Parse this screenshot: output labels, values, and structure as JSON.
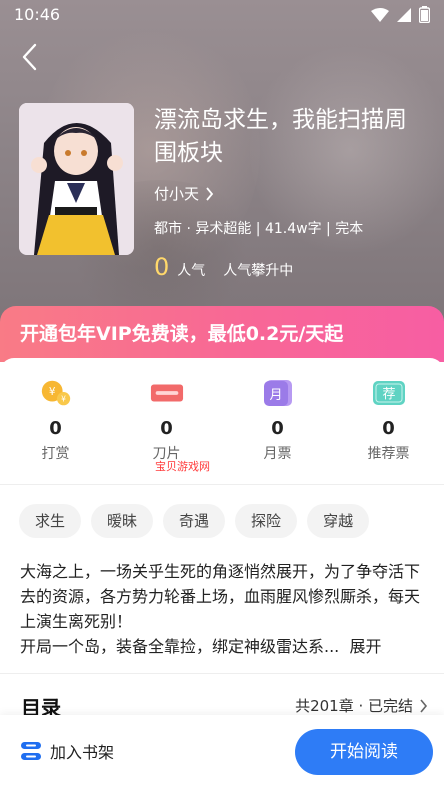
{
  "status_bar": {
    "time": "10:46"
  },
  "book": {
    "title": "漂流岛求生，我能扫描周围板块",
    "author": "付小天",
    "meta": "都市 · 异术超能 | 41.4w字 | 完本",
    "popularity": "0",
    "popularity_label": "人气",
    "rank_label": "人气攀升中"
  },
  "vip_banner": {
    "text": "开通包年VIP免费读，最低0.2元/天起"
  },
  "stats": [
    {
      "value": "0",
      "label": "打赏",
      "icon": "coin-icon"
    },
    {
      "value": "0",
      "label": "刀片",
      "icon": "blade-icon"
    },
    {
      "value": "0",
      "label": "月票",
      "icon": "month-ticket-icon",
      "icon_text": "月"
    },
    {
      "value": "0",
      "label": "推荐票",
      "icon": "recommend-ticket-icon",
      "icon_text": "荐"
    }
  ],
  "watermark": "宝贝游戏网",
  "tags": [
    "求生",
    "暧昧",
    "奇遇",
    "探险",
    "穿越"
  ],
  "description": {
    "line1": "大海之上，一场关乎生死的角逐悄然展开，为了争夺活下去的资源，各方势力轮番上场，血雨腥风惨烈厮杀，每天上演生离死别！",
    "line2": "开局一个岛，装备全靠捡，绑定神级雷达系...",
    "expand": "展开"
  },
  "toc": {
    "title": "目录",
    "info": "共201章 · 已完结"
  },
  "bottom": {
    "shelf_label": "加入书架",
    "read_label": "开始阅读"
  },
  "colors": {
    "accent": "#2e7cf6",
    "vip_start": "#f97b86",
    "vip_end": "#f75ea3",
    "popularity": "#ffd86b"
  }
}
